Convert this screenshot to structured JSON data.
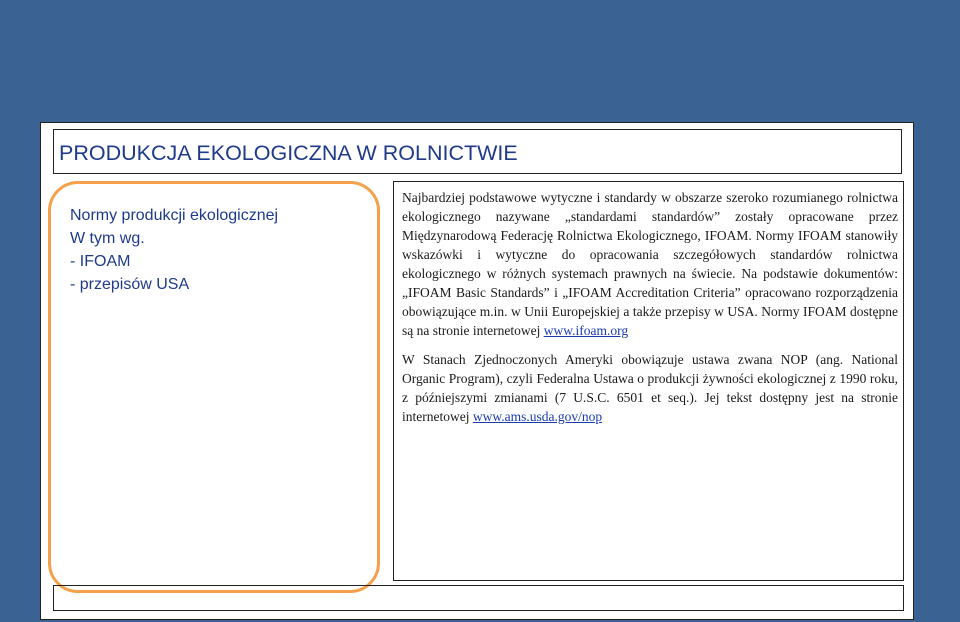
{
  "slide": {
    "title": "PRODUKCJA EKOLOGICZNA W ROLNICTWIE",
    "left_panel": {
      "lines": [
        "Normy produkcji ekologicznej",
        "W tym wg.",
        "- IFOAM",
        "- przepisów USA"
      ]
    },
    "content": {
      "p1_text": "Najbardziej podstawowe wytyczne i standardy w obszarze szeroko rozumianego rolnictwa ekologicznego nazywane „standardami standardów” zostały opracowane przez Międzynarodową Federację Rolnictwa Ekologicznego, IFOAM. Normy IFOAM stanowiły wskazówki i wytyczne do opracowania szczegółowych standardów rolnictwa ekologicznego w różnych systemach prawnych na świecie. Na podstawie dokumentów: „IFOAM Basic Standards” i „IFOAM Accreditation Criteria” opracowano rozporządzenia obowiązujące m.in. w Unii Europejskiej a także przepisy w USA. Normy IFOAM dostępne są na stronie internetowej ",
      "p1_link": "www.ifoam.org",
      "p2_text": "W Stanach Zjednoczonych Ameryki obowiązuje ustawa zwana NOP (ang. National Organic Program), czyli Federalna Ustawa o produkcji żywności ekologicznej z 1990 roku, z późniejszymi zmianami (7 U.S.C. 6501 et seq.). Jej tekst dostępny jest na stronie internetowej ",
      "p2_link": "www.ams.usda.gov/nop"
    }
  },
  "colors": {
    "background": "#3a6293",
    "title_text": "#1f3a8a",
    "panel_border": "#f5a04a",
    "link": "#1a3ab0"
  }
}
